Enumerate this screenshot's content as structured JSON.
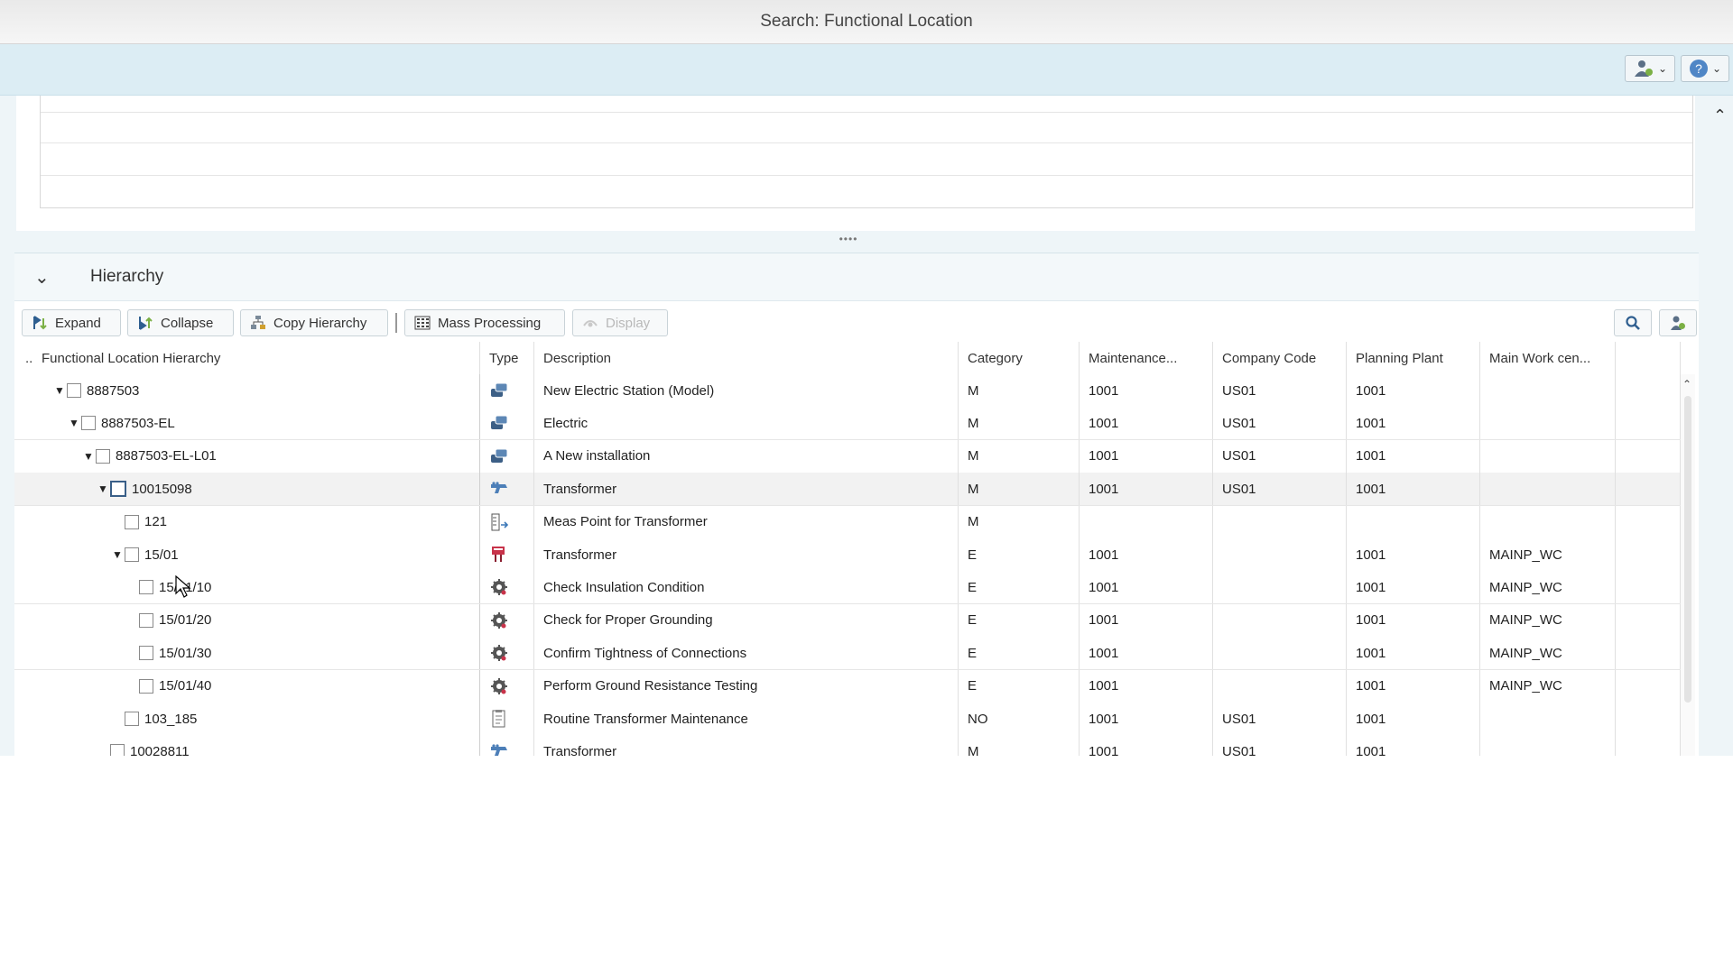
{
  "window": {
    "title": "Search: Functional Location"
  },
  "appbar": {
    "user_icon": "user-settings-icon",
    "help_icon": "help-icon"
  },
  "hierarchy": {
    "section_title": "Hierarchy",
    "toolbar": {
      "expand": "Expand",
      "collapse": "Collapse",
      "copy_hierarchy": "Copy Hierarchy",
      "mass_processing": "Mass Processing",
      "display": "Display"
    },
    "columns": {
      "tree": "Functional Location Hierarchy",
      "type": "Type",
      "description": "Description",
      "category": "Category",
      "maintenance": "Maintenance...",
      "company": "Company Code",
      "plant": "Planning Plant",
      "workcenter": "Main Work cen..."
    },
    "rows": [
      {
        "id": "8887503",
        "level": 0,
        "expand": "down",
        "type_icon": "functional-location-icon",
        "desc": "New Electric Station (Model)",
        "cat": "M",
        "maint": "1001",
        "company": "US01",
        "plant": "1001",
        "wc": ""
      },
      {
        "id": "8887503-EL",
        "level": 1,
        "expand": "down",
        "type_icon": "functional-location-icon",
        "desc": "Electric",
        "cat": "M",
        "maint": "1001",
        "company": "US01",
        "plant": "1001",
        "wc": ""
      },
      {
        "id": "8887503-EL-L01",
        "level": 2,
        "expand": "down",
        "type_icon": "functional-location-icon",
        "desc": "A New installation",
        "cat": "M",
        "maint": "1001",
        "company": "US01",
        "plant": "1001",
        "wc": ""
      },
      {
        "id": "10015098",
        "level": 3,
        "expand": "down",
        "type_icon": "equipment-icon",
        "desc": "Transformer",
        "cat": "M",
        "maint": "1001",
        "company": "US01",
        "plant": "1001",
        "wc": "",
        "selected": true
      },
      {
        "id": "121",
        "level": 4,
        "expand": "",
        "type_icon": "measuring-point-icon",
        "desc": "Meas Point for Transformer",
        "cat": "M",
        "maint": "",
        "company": "",
        "plant": "",
        "wc": ""
      },
      {
        "id": "15/01",
        "level": 4,
        "expand": "down",
        "type_icon": "task-list-icon",
        "desc": "Transformer",
        "cat": "E",
        "maint": "1001",
        "company": "",
        "plant": "1001",
        "wc": "MAINP_WC"
      },
      {
        "id": "15/01/10",
        "level": 5,
        "expand": "",
        "type_icon": "operation-icon",
        "desc": "Check Insulation Condition",
        "cat": "E",
        "maint": "1001",
        "company": "",
        "plant": "1001",
        "wc": "MAINP_WC"
      },
      {
        "id": "15/01/20",
        "level": 5,
        "expand": "",
        "type_icon": "operation-icon",
        "desc": "Check for Proper Grounding",
        "cat": "E",
        "maint": "1001",
        "company": "",
        "plant": "1001",
        "wc": "MAINP_WC"
      },
      {
        "id": "15/01/30",
        "level": 5,
        "expand": "",
        "type_icon": "operation-icon",
        "desc": "Confirm Tightness of Connections",
        "cat": "E",
        "maint": "1001",
        "company": "",
        "plant": "1001",
        "wc": "MAINP_WC"
      },
      {
        "id": "15/01/40",
        "level": 5,
        "expand": "",
        "type_icon": "operation-icon",
        "desc": "Perform Ground Resistance Testing",
        "cat": "E",
        "maint": "1001",
        "company": "",
        "plant": "1001",
        "wc": "MAINP_WC"
      },
      {
        "id": "103_185",
        "level": 4,
        "expand": "",
        "type_icon": "maintenance-plan-icon",
        "desc": "Routine Transformer Maintenance",
        "cat": "NO",
        "maint": "1001",
        "company": "US01",
        "plant": "1001",
        "wc": ""
      },
      {
        "id": "10028811",
        "level": 3,
        "expand": "",
        "type_icon": "equipment-icon",
        "desc": "Transformer",
        "cat": "M",
        "maint": "1001",
        "company": "US01",
        "plant": "1001",
        "wc": ""
      }
    ]
  }
}
